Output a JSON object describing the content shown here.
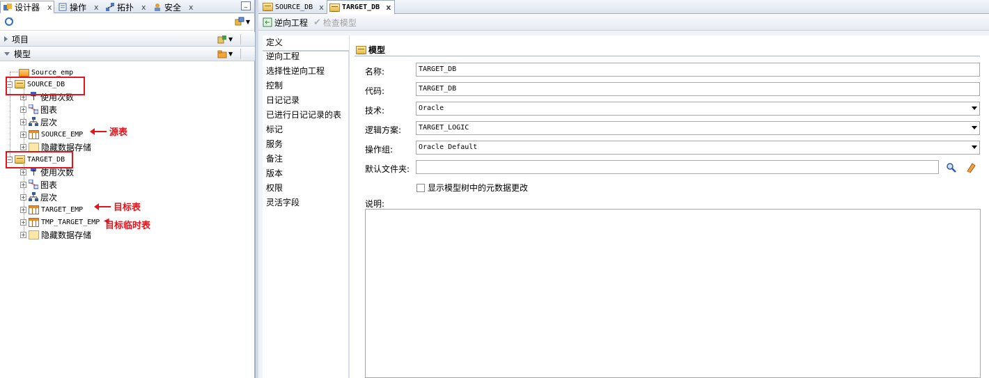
{
  "left_tabs": [
    {
      "label": "设计器",
      "icon": "designer-icon"
    },
    {
      "label": "操作",
      "icon": "operations-icon"
    },
    {
      "label": "拓扑",
      "icon": "topology-icon"
    },
    {
      "label": "安全",
      "icon": "security-icon"
    }
  ],
  "close_glyph": "x",
  "accordion": {
    "projects": "项目",
    "models": "模型"
  },
  "tree": {
    "source_emp_folder": "Source_emp",
    "source_db": "SOURCE_DB",
    "target_db": "TARGET_DB",
    "usage": "使用次数",
    "diagram": "图表",
    "hierarchy": "层次",
    "source_emp": "SOURCE_EMP",
    "target_emp": "TARGET_EMP",
    "tmp_target_emp": "TMP_TARGET_EMP",
    "hidden_store": "隐藏数据存储"
  },
  "annotations": {
    "source_table": "源表",
    "target_table": "目标表",
    "target_temp_table": "目标临时表"
  },
  "editor_tabs": [
    {
      "label": "SOURCE_DB"
    },
    {
      "label": "TARGET_DB"
    }
  ],
  "toolbar": {
    "reverse_engineer": "逆向工程",
    "check_model": "检查模型"
  },
  "nav_items": [
    "定义",
    "逆向工程",
    "选择性逆向工程",
    "控制",
    "日记记录",
    "已进行日记记录的表",
    "标记",
    "服务",
    "备注",
    "版本",
    "权限",
    "灵活字段"
  ],
  "form": {
    "title": "模型",
    "name_label": "名称:",
    "name_value": "TARGET_DB",
    "code_label": "代码:",
    "code_value": "TARGET_DB",
    "tech_label": "技术:",
    "tech_value": "Oracle",
    "schema_label": "逻辑方案:",
    "schema_value": "TARGET_LOGIC",
    "opgroup_label": "操作组:",
    "opgroup_value": "Oracle Default",
    "folder_label": "默认文件夹:",
    "folder_value": "",
    "checkbox_label": "显示模型树中的元数据更改",
    "desc_label": "说明:"
  }
}
